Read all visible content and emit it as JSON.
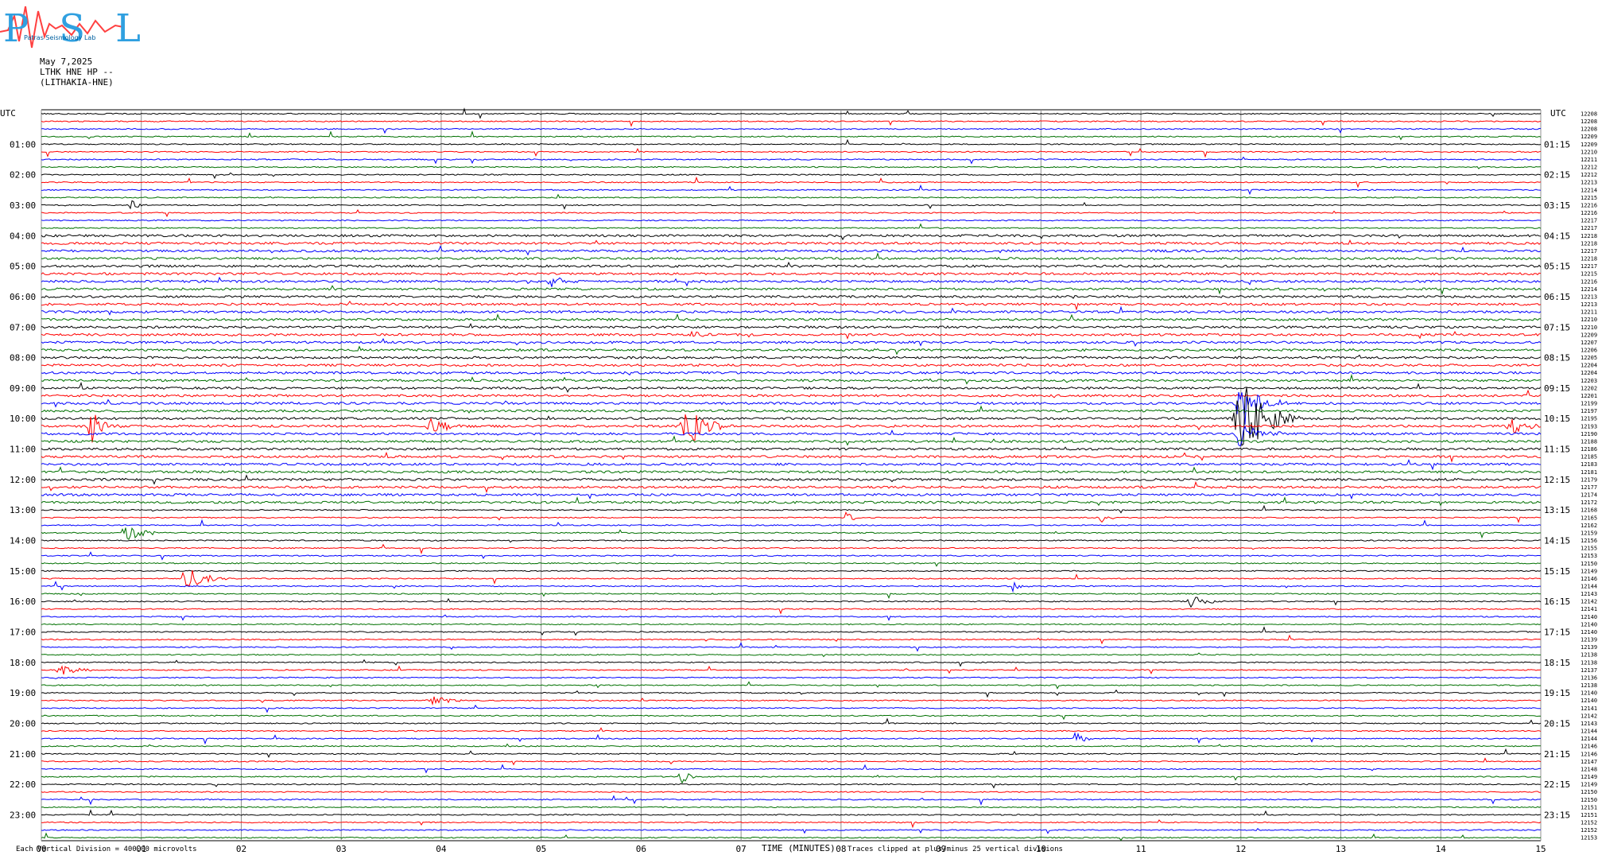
{
  "header": {
    "logo_letters": "PSL",
    "logo_text": "Patras Seismology Lab",
    "date": "May 7,2025",
    "station": "LTHK HNE HP --",
    "station_name": "(LITHAKIA-HNE)"
  },
  "chart_data": {
    "type": "line",
    "title": "",
    "left_axis_label": "UTC",
    "right_axis_label": "UTC",
    "xlabel": "TIME (MINUTES)",
    "xlim": [
      0,
      15
    ],
    "x_ticks": [
      "00",
      "01",
      "02",
      "03",
      "04",
      "05",
      "06",
      "07",
      "08",
      "09",
      "10",
      "11",
      "12",
      "13",
      "14",
      "15"
    ],
    "left_hour_labels": [
      "01:00",
      "02:00",
      "03:00",
      "04:00",
      "05:00",
      "06:00",
      "07:00",
      "08:00",
      "09:00",
      "10:00",
      "11:00",
      "12:00",
      "13:00",
      "14:00",
      "15:00",
      "16:00",
      "17:00",
      "18:00",
      "19:00",
      "20:00",
      "21:00",
      "22:00",
      "23:00"
    ],
    "right_hour_labels": [
      "01:15",
      "02:15",
      "03:15",
      "04:15",
      "05:15",
      "06:15",
      "07:15",
      "08:15",
      "09:15",
      "10:15",
      "11:15",
      "12:15",
      "13:15",
      "14:15",
      "15:15",
      "16:15",
      "17:15",
      "18:15",
      "19:15",
      "20:15",
      "21:15",
      "22:15",
      "23:15"
    ],
    "trace_count": 96,
    "trace_color_cycle": [
      "#000000",
      "#ff0000",
      "#0000ff",
      "#007000"
    ],
    "right_trace_values": [
      "12208",
      "12208",
      "12208",
      "12209",
      "12209",
      "12210",
      "12211",
      "12212",
      "12212",
      "12213",
      "12214",
      "12215",
      "12216",
      "12216",
      "12217",
      "12217",
      "12218",
      "12218",
      "12217",
      "12218",
      "12217",
      "12215",
      "12216",
      "12214",
      "12213",
      "12213",
      "12211",
      "12210",
      "12210",
      "12209",
      "12207",
      "12206",
      "12205",
      "12204",
      "12204",
      "12203",
      "12202",
      "12201",
      "12199",
      "12197",
      "12195",
      "12193",
      "12190",
      "12188",
      "12186",
      "12185",
      "12183",
      "12181",
      "12179",
      "12177",
      "12174",
      "12172",
      "12168",
      "12165",
      "12162",
      "12159",
      "12156",
      "12155",
      "12153",
      "12150",
      "12149",
      "12146",
      "12144",
      "12143",
      "12142",
      "12141",
      "12140",
      "12140",
      "12140",
      "12139",
      "12139",
      "12138",
      "12138",
      "12137",
      "12136",
      "12138",
      "12140",
      "12140",
      "12141",
      "12142",
      "12143",
      "12144",
      "12144",
      "12146",
      "12146",
      "12147",
      "12148",
      "12149",
      "12149",
      "12150",
      "12150",
      "12151",
      "12151",
      "12152",
      "12152",
      "12153"
    ],
    "events": [
      {
        "trace": 40,
        "minute": 12.0,
        "amp": 7,
        "dur": 0.6
      },
      {
        "trace": 38,
        "minute": 12.0,
        "amp": 3.5,
        "dur": 0.5
      },
      {
        "trace": 42,
        "minute": 12.0,
        "amp": 2.5,
        "dur": 0.4
      },
      {
        "trace": 41,
        "minute": 6.45,
        "amp": 3.0,
        "dur": 0.5
      },
      {
        "trace": 41,
        "minute": 0.5,
        "amp": 2.5,
        "dur": 0.3
      },
      {
        "trace": 41,
        "minute": 14.7,
        "amp": 1.5,
        "dur": 0.3
      },
      {
        "trace": 41,
        "minute": 3.9,
        "amp": 1.2,
        "dur": 0.4
      },
      {
        "trace": 61,
        "minute": 1.45,
        "amp": 2.2,
        "dur": 0.4
      },
      {
        "trace": 55,
        "minute": 0.85,
        "amp": 1.2,
        "dur": 0.4
      },
      {
        "trace": 87,
        "minute": 6.4,
        "amp": 1.2,
        "dur": 0.2
      },
      {
        "trace": 82,
        "minute": 10.35,
        "amp": 1.1,
        "dur": 0.2
      },
      {
        "trace": 77,
        "minute": 3.9,
        "amp": 0.8,
        "dur": 0.4
      },
      {
        "trace": 73,
        "minute": 0.2,
        "amp": 0.8,
        "dur": 0.4
      },
      {
        "trace": 64,
        "minute": 11.5,
        "amp": 0.8,
        "dur": 0.4
      },
      {
        "trace": 62,
        "minute": 9.7,
        "amp": 1.0,
        "dur": 0.2
      },
      {
        "trace": 53,
        "minute": 8.05,
        "amp": 0.8,
        "dur": 0.2
      },
      {
        "trace": 53,
        "minute": 10.6,
        "amp": 0.8,
        "dur": 0.2
      },
      {
        "trace": 22,
        "minute": 5.1,
        "amp": 0.8,
        "dur": 0.3
      },
      {
        "trace": 12,
        "minute": 0.9,
        "amp": 0.8,
        "dur": 0.2
      },
      {
        "trace": 29,
        "minute": 6.5,
        "amp": 0.9,
        "dur": 0.2
      }
    ],
    "footer_left": "Each Vertical Division =  400.00 microvolts",
    "footer_right": "Traces clipped at plus/minus 25 vertical divisions"
  }
}
